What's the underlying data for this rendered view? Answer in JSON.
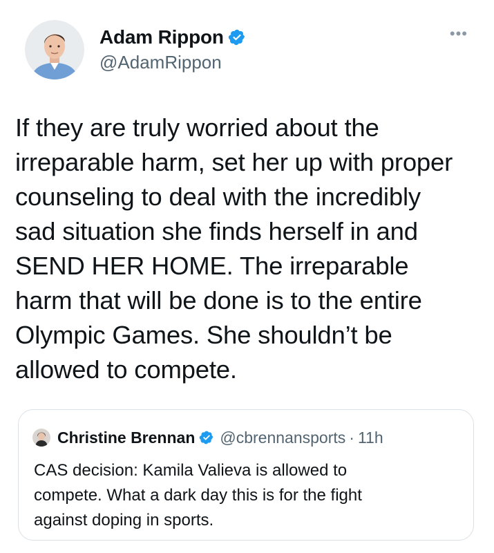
{
  "tweet": {
    "author": {
      "display_name": "Adam Rippon",
      "handle": "@AdamRippon",
      "avatar_icon": "profile-photo",
      "verified_icon": "verified-badge-icon"
    },
    "more_icon": "more-options-icon",
    "more_glyph": "•••",
    "text": "If they are truly worried about the\nirreparable harm, set her up with proper\ncounseling to deal with the incredibly\nsad situation she finds herself in and\nSEND HER HOME. The irreparable\nharm that will be done is to the entire\nOlympic Games. She shouldn’t be\nallowed to compete."
  },
  "quoted_tweet": {
    "author": {
      "display_name": "Christine Brennan",
      "handle": "@cbrennansports",
      "separator": "·",
      "time": "11h",
      "avatar_icon": "profile-photo",
      "verified_icon": "verified-badge-icon"
    },
    "text": "CAS decision: Kamila Valieva is allowed to\ncompete. What a dark day this is for the fight\nagainst doping in sports."
  },
  "colors": {
    "verified_blue": "#1d9bf0",
    "text_primary": "#0f1419",
    "text_secondary": "#536471",
    "border": "#dbe1e6"
  }
}
